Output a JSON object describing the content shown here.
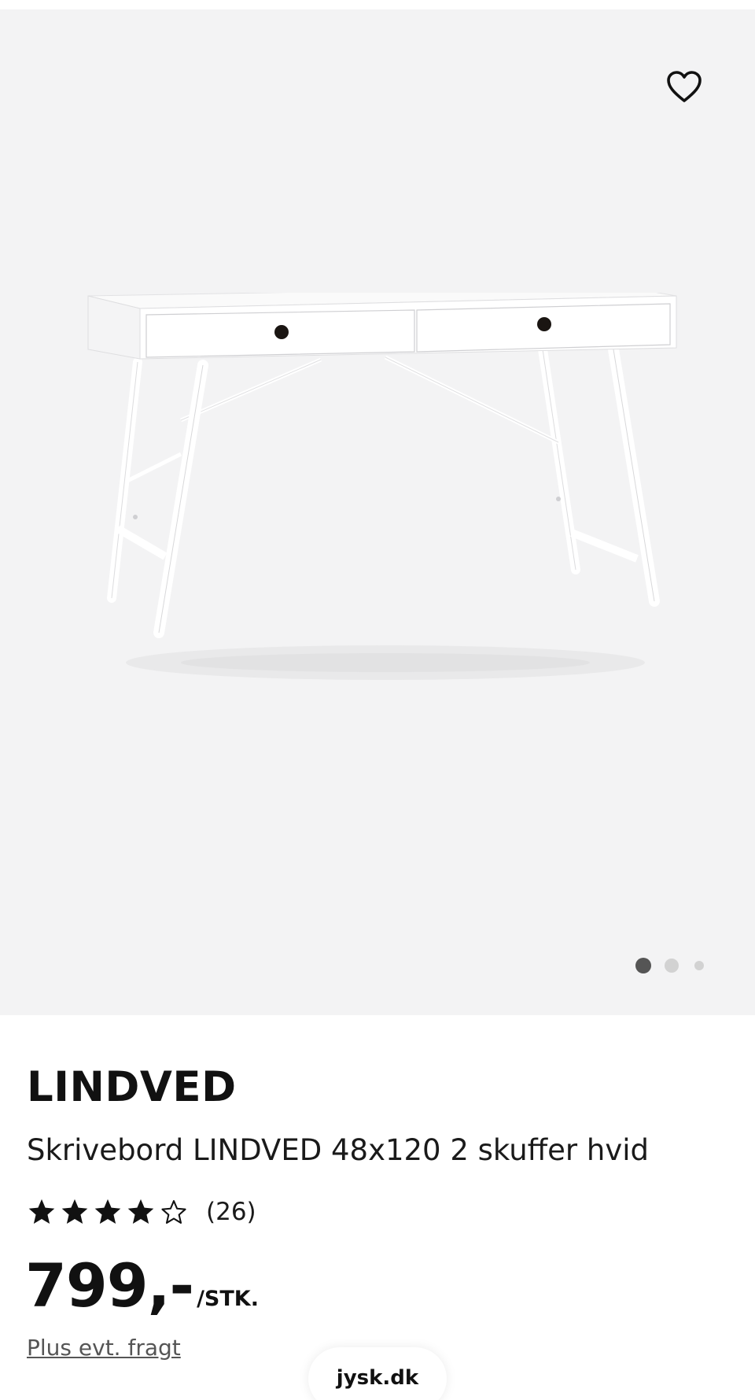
{
  "gallery": {
    "favorite_icon": "heart-outline-icon",
    "image_subject": "white-desk-two-drawers",
    "carousel": {
      "total_slides": 3,
      "active_index": 0
    },
    "background_color": "#f3f3f4"
  },
  "product": {
    "brand": "LINDVED",
    "title": "Skrivebord LINDVED 48x120 2 skuffer hvid",
    "rating": {
      "value": 4,
      "max": 5,
      "review_count": "(26)",
      "icons": [
        "star-filled-icon",
        "star-filled-icon",
        "star-filled-icon",
        "star-filled-icon",
        "star-outline-icon"
      ]
    },
    "price": "799,-",
    "unit": "/STK.",
    "shipping_note": "Plus evt. fragt"
  },
  "browser": {
    "domain": "jysk.dk"
  }
}
